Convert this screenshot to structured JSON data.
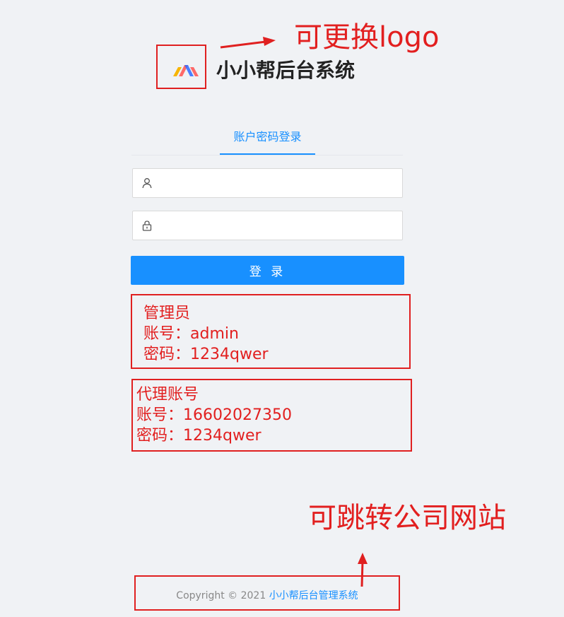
{
  "header": {
    "app_title": "小小帮后台系统",
    "logo_colors": [
      "#f7b500",
      "#ff5a5a",
      "#2f6bff"
    ]
  },
  "annotations": {
    "logo_note": "可更换logo",
    "site_note": "可跳转公司网站",
    "color": "#e21f1f"
  },
  "login": {
    "tabs": [
      {
        "label": "账户密码登录",
        "active": true
      }
    ],
    "username": {
      "value": "",
      "placeholder": "",
      "icon": "user-icon"
    },
    "password": {
      "value": "",
      "placeholder": "",
      "icon": "lock-icon"
    },
    "submit_label": "登 录",
    "accent_color": "#1890ff"
  },
  "credentials": {
    "admin": {
      "title": "管理员",
      "account_line": "账号：admin",
      "password_line": "密码：1234qwer"
    },
    "agent": {
      "title": "代理账号",
      "account_line": "账号：16602027350",
      "password_line": "密码：1234qwer"
    }
  },
  "footer": {
    "copyright": "Copyright © 2021 ",
    "link_text": "小小帮后台管理系统"
  }
}
